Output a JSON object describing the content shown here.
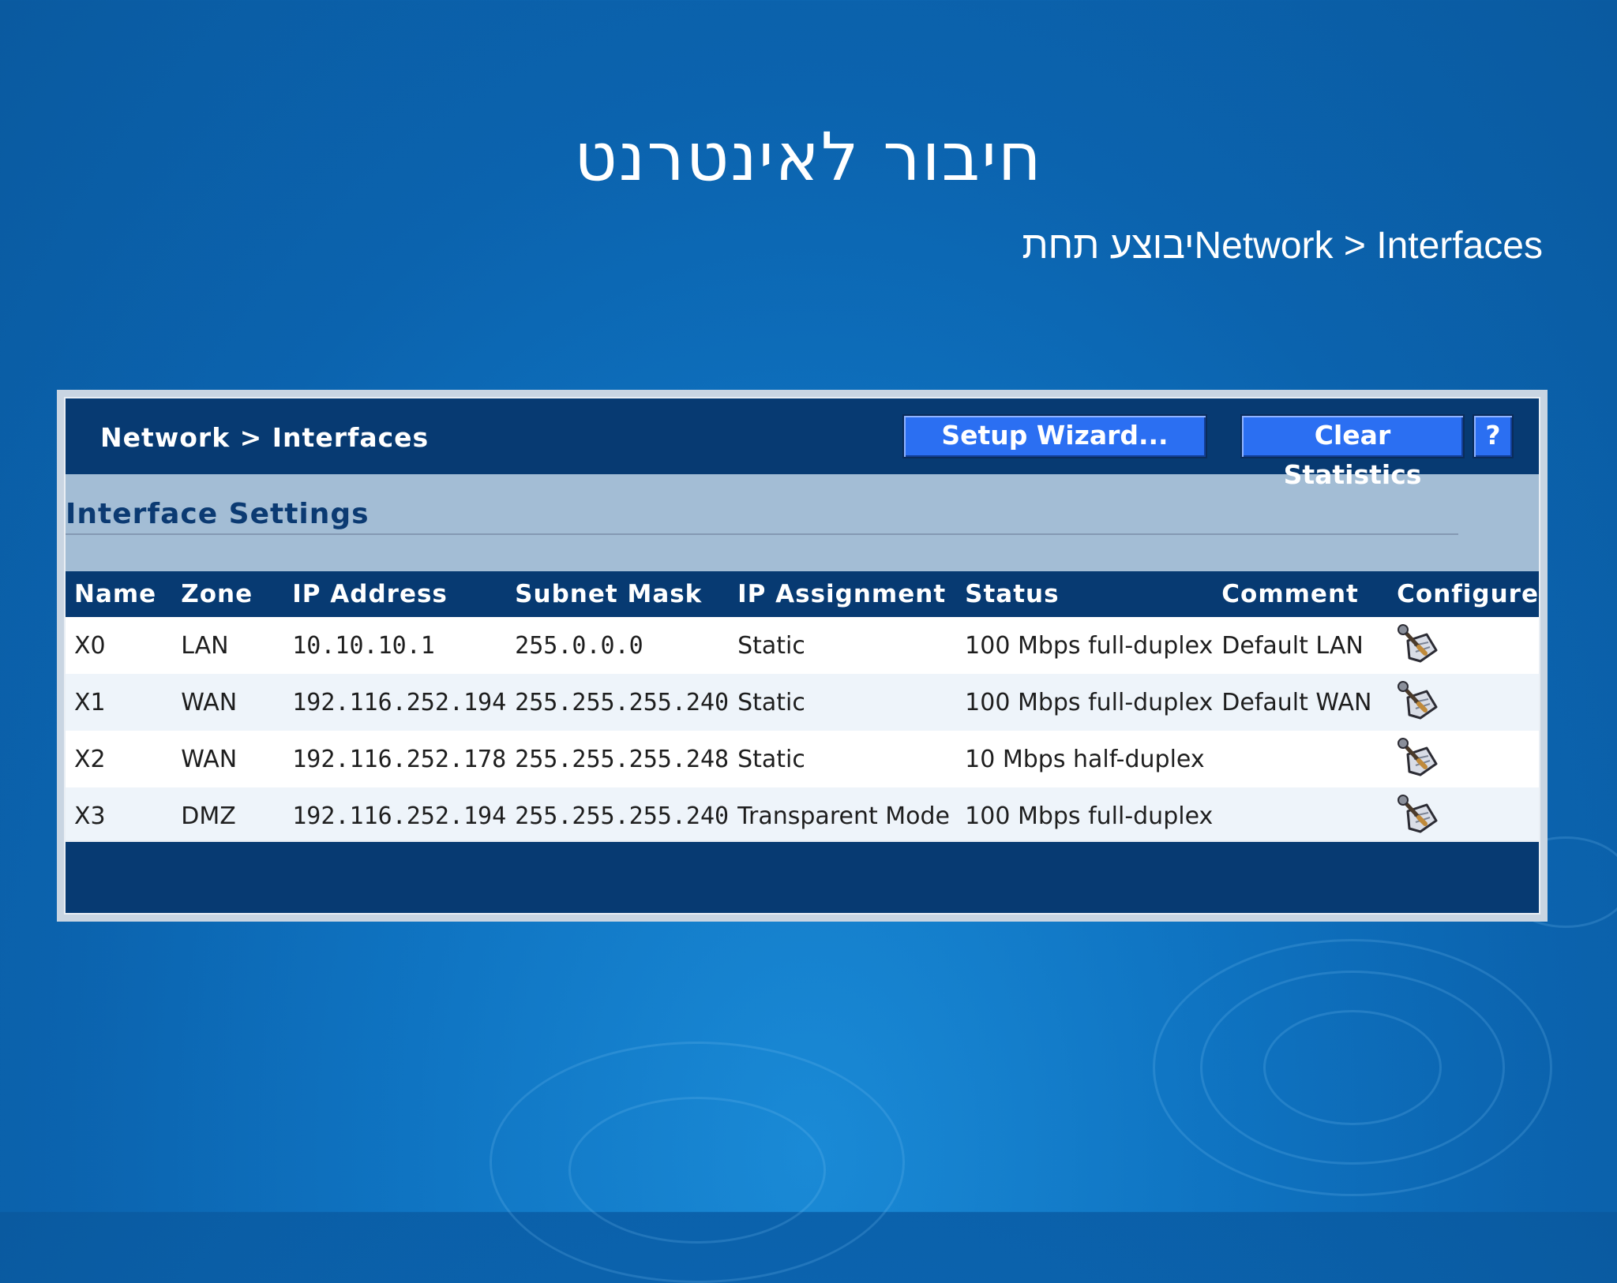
{
  "slide": {
    "title": "חיבור לאינטרנט",
    "subtitle": "יבוצע תחתNetwork > Interfaces"
  },
  "topbar": {
    "breadcrumb": "Network > Interfaces",
    "setup_wizard_label": "Setup Wizard...",
    "clear_statistics_label": "Clear Statistics",
    "help_label": "?"
  },
  "section": {
    "title": "Interface Settings"
  },
  "table": {
    "headers": {
      "name": "Name",
      "zone": "Zone",
      "ip": "IP Address",
      "mask": "Subnet Mask",
      "assignment": "IP Assignment",
      "status": "Status",
      "comment": "Comment",
      "configure": "Configure"
    },
    "rows": [
      {
        "name": "X0",
        "zone": "LAN",
        "ip": "10.10.10.1",
        "mask": "255.0.0.0",
        "assignment": "Static",
        "status": "100 Mbps full-duplex",
        "comment": "Default LAN",
        "configure_icon": "configure-icon"
      },
      {
        "name": "X1",
        "zone": "WAN",
        "ip": "192.116.252.194",
        "mask": "255.255.255.240",
        "assignment": "Static",
        "status": "100 Mbps full-duplex",
        "comment": "Default WAN",
        "configure_icon": "configure-icon"
      },
      {
        "name": "X2",
        "zone": "WAN",
        "ip": "192.116.252.178",
        "mask": "255.255.255.248",
        "assignment": "Static",
        "status": "10 Mbps half-duplex",
        "comment": "",
        "configure_icon": "configure-icon"
      },
      {
        "name": "X3",
        "zone": "DMZ",
        "ip": "192.116.252.194",
        "mask": "255.255.255.240",
        "assignment": "Transparent Mode",
        "status": "100 Mbps full-duplex",
        "comment": "",
        "configure_icon": "configure-icon"
      }
    ]
  },
  "colors": {
    "background": "#0b63ae",
    "header_bar": "#073a72",
    "button": "#2b6ff2",
    "panel": "#a3bdd5"
  }
}
